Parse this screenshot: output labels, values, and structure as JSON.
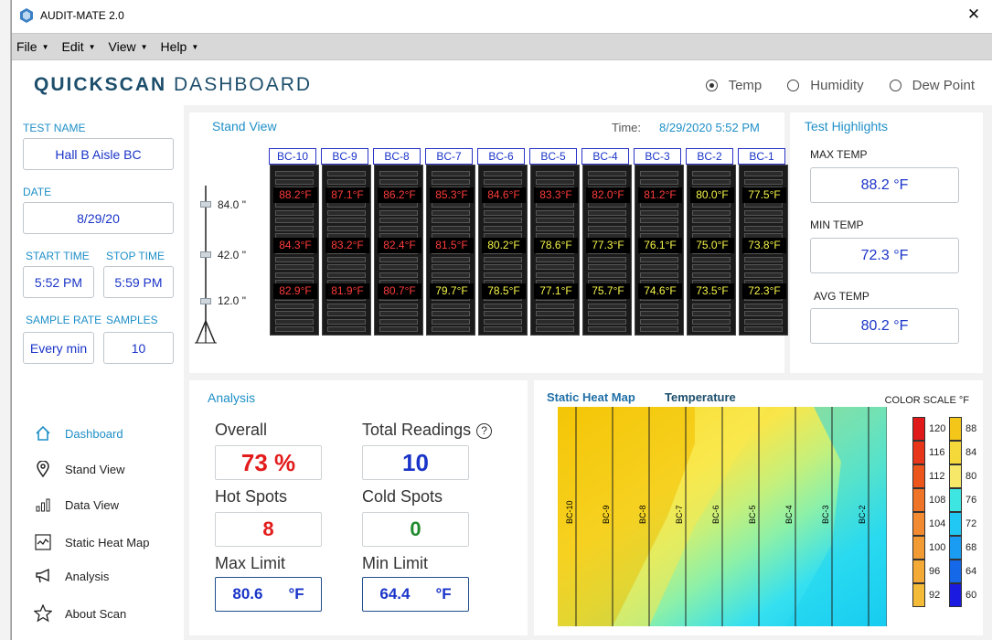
{
  "window": {
    "title": "AUDIT-MATE 2.0",
    "close_icon": "x-icon"
  },
  "menu": [
    {
      "label": "File"
    },
    {
      "label": "Edit"
    },
    {
      "label": "View"
    },
    {
      "label": "Help"
    }
  ],
  "header": {
    "brand_bold": "QUICKSCAN",
    "brand_rest": "DASHBOARD",
    "radios": [
      {
        "label": "Temp",
        "checked": true
      },
      {
        "label": "Humidity",
        "checked": false
      },
      {
        "label": "Dew Point",
        "checked": false
      }
    ]
  },
  "sidebar": {
    "test_name_label": "TEST NAME",
    "test_name": "Hall B Aisle BC",
    "date_label": "DATE",
    "date": "8/29/20",
    "start_time_label": "START TIME",
    "start_time": "5:52 PM",
    "stop_time_label": "STOP TIME",
    "stop_time": "5:59 PM",
    "sample_rate_label": "SAMPLE RATE",
    "sample_rate": "Every min",
    "samples_label": "SAMPLES",
    "samples": "10",
    "nav": [
      {
        "label": "Dashboard",
        "icon": "home-icon",
        "active": true
      },
      {
        "label": "Stand View",
        "icon": "map-pin-icon",
        "active": false
      },
      {
        "label": "Data View",
        "icon": "bar-chart-icon",
        "active": false
      },
      {
        "label": "Static Heat Map",
        "icon": "pulse-chart-icon",
        "active": false
      },
      {
        "label": "Analysis",
        "icon": "megaphone-icon",
        "active": false
      },
      {
        "label": "About Scan",
        "icon": "star-icon",
        "active": false
      }
    ]
  },
  "stand_view": {
    "title": "Stand View",
    "time_label": "Time:",
    "time_value": "8/29/2020 5:52 PM",
    "heights": [
      "84.0 \"",
      "42.0 \"",
      "12.0 \""
    ],
    "racks": [
      {
        "name": "BC-10",
        "top": "88.2°F",
        "mid": "84.3°F",
        "bot": "82.9°F"
      },
      {
        "name": "BC-9",
        "top": "87.1°F",
        "mid": "83.2°F",
        "bot": "81.9°F"
      },
      {
        "name": "BC-8",
        "top": "86.2°F",
        "mid": "82.4°F",
        "bot": "80.7°F"
      },
      {
        "name": "BC-7",
        "top": "85.3°F",
        "mid": "81.5°F",
        "bot": "79.7°F"
      },
      {
        "name": "BC-6",
        "top": "84.6°F",
        "mid": "80.2°F",
        "bot": "78.5°F"
      },
      {
        "name": "BC-5",
        "top": "83.3°F",
        "mid": "78.6°F",
        "bot": "77.1°F"
      },
      {
        "name": "BC-4",
        "top": "82.0°F",
        "mid": "77.3°F",
        "bot": "75.7°F"
      },
      {
        "name": "BC-3",
        "top": "81.2°F",
        "mid": "76.1°F",
        "bot": "74.6°F"
      },
      {
        "name": "BC-2",
        "top": "80.0°F",
        "mid": "75.0°F",
        "bot": "73.5°F"
      },
      {
        "name": "BC-1",
        "top": "77.5°F",
        "mid": "73.8°F",
        "bot": "72.3°F"
      }
    ],
    "colors": {
      "hot": "#ff3b3b",
      "normal": "#f7f74a"
    }
  },
  "highlights": {
    "title": "Test Highlights",
    "max_label": "MAX TEMP",
    "max_value": "88.2 °F",
    "min_label": "MIN TEMP",
    "min_value": "72.3 °F",
    "avg_label": "AVG TEMP",
    "avg_value": "80.2 °F"
  },
  "analysis": {
    "title": "Analysis",
    "overall_label": "Overall",
    "overall_value": "73 %",
    "total_label": "Total Readings",
    "total_value": "10",
    "hot_label": "Hot Spots",
    "hot_value": "8",
    "cold_label": "Cold Spots",
    "cold_value": "0",
    "max_label": "Max Limit",
    "max_value": "80.6",
    "max_unit": "°F",
    "min_label": "Min Limit",
    "min_value": "64.4",
    "min_unit": "°F",
    "help_icon": "question-circle-icon"
  },
  "heatmap": {
    "title": "Static Heat Map",
    "subtitle": "Temperature",
    "scale_title": "COLOR SCALE °F",
    "columns": [
      "BC-10",
      "BC-9",
      "BC-8",
      "BC-7",
      "BC-6",
      "BC-5",
      "BC-4",
      "BC-3",
      "BC-2"
    ],
    "scale_hot": [
      "120",
      "116",
      "112",
      "108",
      "104",
      "100",
      "96",
      "92"
    ],
    "scale_cool": [
      "88",
      "84",
      "80",
      "76",
      "72",
      "68",
      "64",
      "60"
    ]
  }
}
